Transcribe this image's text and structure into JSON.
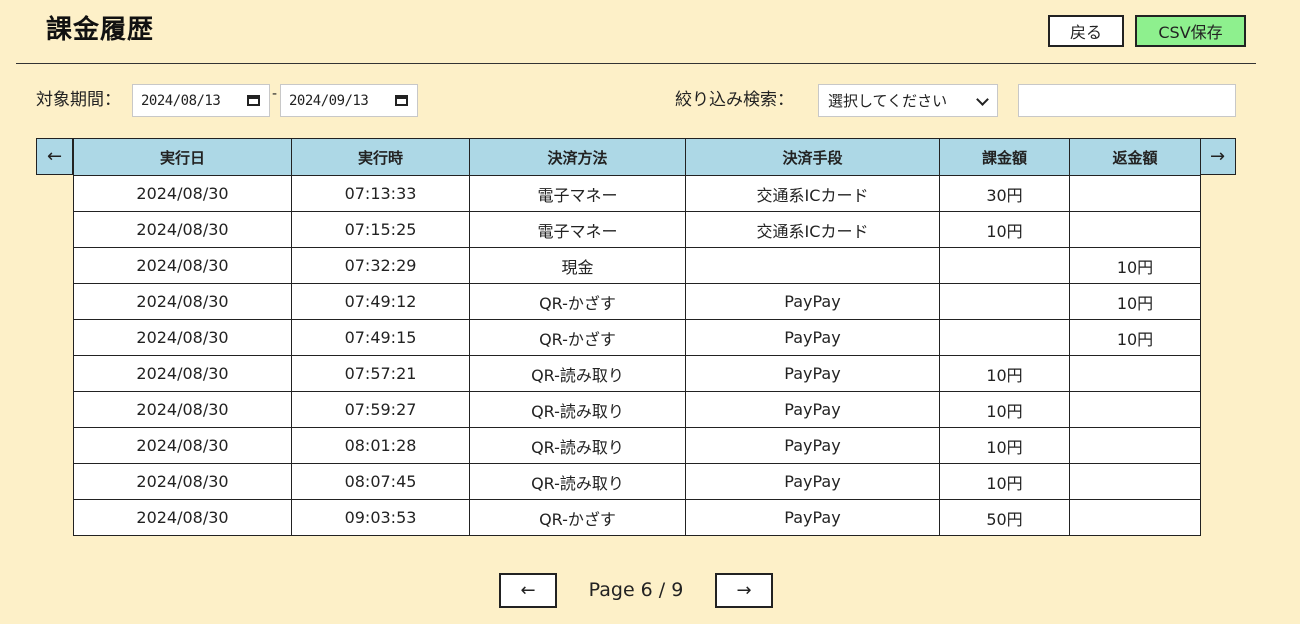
{
  "header": {
    "title": "課金履歴",
    "back_label": "戻る",
    "csv_label": "CSV保存"
  },
  "filters": {
    "period_label": "対象期間：",
    "date_from": "2024/08/13",
    "date_separator": "-",
    "date_to": "2024/09/13",
    "search_label": "絞り込み検索：",
    "search_select_value": "選択してください",
    "search_input_value": ""
  },
  "table": {
    "nav_left": "←",
    "nav_right": "→",
    "columns": [
      "実行日",
      "実行時",
      "決済方法",
      "決済手段",
      "課金額",
      "返金額"
    ],
    "rows": [
      [
        "2024/08/30",
        "07:13:33",
        "電子マネー",
        "交通系ICカード",
        "30円",
        ""
      ],
      [
        "2024/08/30",
        "07:15:25",
        "電子マネー",
        "交通系ICカード",
        "10円",
        ""
      ],
      [
        "2024/08/30",
        "07:32:29",
        "現金",
        "",
        "",
        "10円"
      ],
      [
        "2024/08/30",
        "07:49:12",
        "QR-かざす",
        "PayPay",
        "",
        "10円"
      ],
      [
        "2024/08/30",
        "07:49:15",
        "QR-かざす",
        "PayPay",
        "",
        "10円"
      ],
      [
        "2024/08/30",
        "07:57:21",
        "QR-読み取り",
        "PayPay",
        "10円",
        ""
      ],
      [
        "2024/08/30",
        "07:59:27",
        "QR-読み取り",
        "PayPay",
        "10円",
        ""
      ],
      [
        "2024/08/30",
        "08:01:28",
        "QR-読み取り",
        "PayPay",
        "10円",
        ""
      ],
      [
        "2024/08/30",
        "08:07:45",
        "QR-読み取り",
        "PayPay",
        "10円",
        ""
      ],
      [
        "2024/08/30",
        "09:03:53",
        "QR-かざす",
        "PayPay",
        "50円",
        ""
      ]
    ]
  },
  "pagination": {
    "prev_label": "←",
    "next_label": "→",
    "page_text": "Page 6 / 9"
  },
  "colors": {
    "background": "#fdf0c8",
    "header_cell": "#add8e6",
    "csv_button": "#8ef08e"
  }
}
